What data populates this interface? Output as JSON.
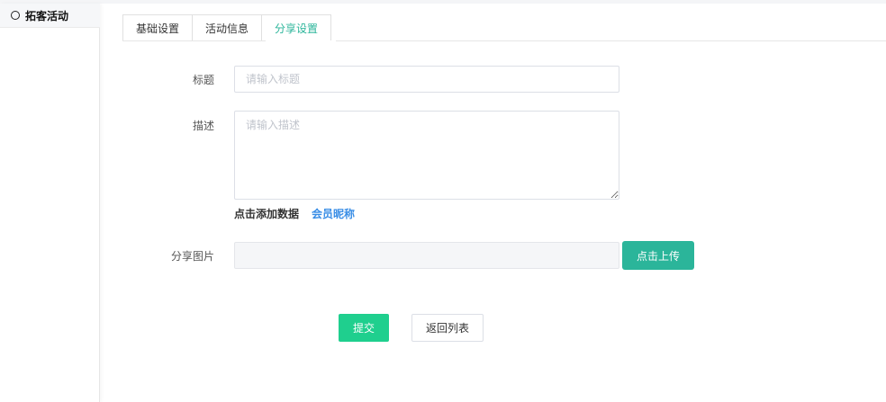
{
  "sidebar": {
    "items": [
      {
        "label": "拓客活动",
        "icon": "circle-icon"
      }
    ]
  },
  "tabs": [
    {
      "label": "基础设置",
      "active": false
    },
    {
      "label": "活动信息",
      "active": false
    },
    {
      "label": "分享设置",
      "active": true
    }
  ],
  "form": {
    "title": {
      "label": "标题",
      "placeholder": "请输入标题",
      "value": ""
    },
    "description": {
      "label": "描述",
      "placeholder": "请输入描述",
      "value": ""
    },
    "add_data_label": "点击添加数据",
    "nickname_link": "会员昵称",
    "share_image": {
      "label": "分享图片",
      "upload_label": "点击上传"
    },
    "submit_label": "提交",
    "back_label": "返回列表"
  },
  "colors": {
    "accent": "#2bb59a",
    "submit": "#1fcf8e",
    "link": "#3a8ee6"
  }
}
